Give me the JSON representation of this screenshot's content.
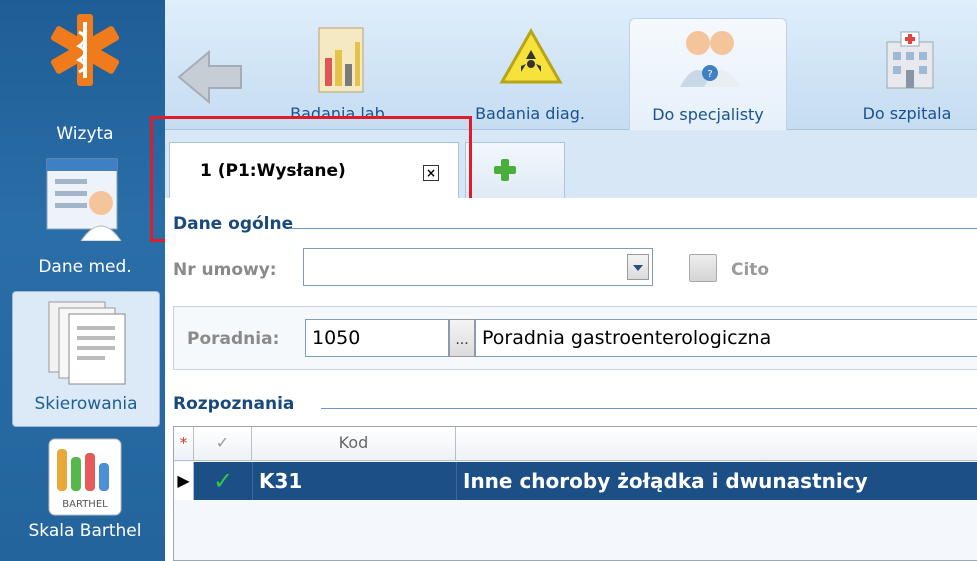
{
  "sidebar": {
    "items": [
      {
        "label": "Wizyta",
        "icon": "medical-star-icon"
      },
      {
        "label": "Dane med.",
        "icon": "patient-card-icon"
      },
      {
        "label": "Skierowania",
        "icon": "referral-documents-icon"
      },
      {
        "label": "Skala Barthel",
        "icon": "barthel-scale-icon",
        "badge": "BARTHEL"
      }
    ]
  },
  "toolbar": {
    "back_icon": "back-arrow-icon",
    "items": [
      {
        "label": "Badania lab.",
        "icon": "lab-tests-icon"
      },
      {
        "label": "Badania diag.",
        "icon": "radiation-warning-icon"
      },
      {
        "label": "Do specjalisty",
        "icon": "specialists-icon"
      },
      {
        "label": "Do szpitala",
        "icon": "hospital-icon"
      }
    ]
  },
  "tabs": {
    "items": [
      {
        "label": "1 (P1:Wysłane)",
        "close": "×"
      }
    ],
    "add_icon": "green-plus-icon"
  },
  "general": {
    "title": "Dane ogólne",
    "contract_label": "Nr umowy:",
    "contract_value": "",
    "cito_label": "Cito",
    "clinic_label": "Poradnia:",
    "clinic_code": "1050",
    "clinic_browse": "...",
    "clinic_name": "Poradnia gastroenterologiczna"
  },
  "diagnoses": {
    "title": "Rozpoznania",
    "columns": [
      "*",
      "✓",
      "Kod",
      ""
    ],
    "rows": [
      {
        "indicator": "▶",
        "check": "✓",
        "code": "K31",
        "name": "Inne choroby żołądka i dwunastnicy"
      }
    ]
  },
  "colors": {
    "accent": "#1f5d96",
    "selected_row": "#1c4f86",
    "highlight_box": "#e01c2a",
    "check_green": "#2ecc40"
  }
}
